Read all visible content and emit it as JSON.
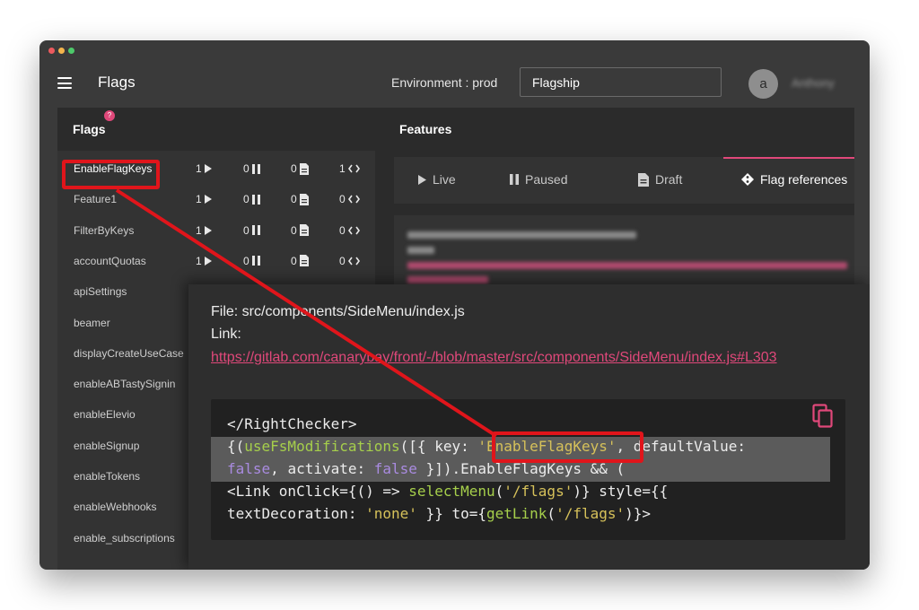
{
  "window": {
    "traffic_colors": [
      "#ec5a5e",
      "#f3b44c",
      "#4dc96a"
    ]
  },
  "header": {
    "app_title": "Flags",
    "environment_label": "Environment : prod",
    "project_value": "Flagship",
    "avatar_initial": "a",
    "user_name": "Anthony"
  },
  "flags_panel": {
    "heading": "Flags",
    "help_badge": "?",
    "flags": [
      {
        "name": "EnableFlagKeys",
        "live": "1",
        "paused": "0",
        "draft": "0",
        "refs": "1"
      },
      {
        "name": "Feature1",
        "live": "1",
        "paused": "0",
        "draft": "0",
        "refs": "0"
      },
      {
        "name": "FilterByKeys",
        "live": "1",
        "paused": "0",
        "draft": "0",
        "refs": "0"
      },
      {
        "name": "accountQuotas",
        "live": "1",
        "paused": "0",
        "draft": "0",
        "refs": "0"
      },
      {
        "name": "apiSettings"
      },
      {
        "name": "beamer"
      },
      {
        "name": "displayCreateUseCase"
      },
      {
        "name": "enableABTastySignin"
      },
      {
        "name": "enableElevio"
      },
      {
        "name": "enableSignup"
      },
      {
        "name": "enableTokens"
      },
      {
        "name": "enableWebhooks"
      },
      {
        "name": "enable_subscriptions"
      }
    ]
  },
  "features_panel": {
    "heading": "Features",
    "tabs": [
      {
        "label": "Live",
        "icon": "play-icon"
      },
      {
        "label": "Paused",
        "icon": "pause-icon"
      },
      {
        "label": "Draft",
        "icon": "document-icon"
      },
      {
        "label": "Flag references",
        "icon": "git-diamond-icon"
      }
    ],
    "active_tab": "Flag references"
  },
  "reference_popup": {
    "file_line": "File: src/components/SideMenu/index.js",
    "link_label": "Link:",
    "link_url": "https://gitlab.com/canarybay/front/-/blob/master/src/components/SideMenu/index.js#L303",
    "code": {
      "line1": "</RightChecker>",
      "line2a": "{(",
      "line2_fn": "useFsModifications",
      "line2b": "([{ key: ",
      "line2_str": "'EnableFlagKeys'",
      "line2c": ", defaultValue:",
      "line3_kw1": "false",
      "line3a": ", activate: ",
      "line3_kw2": "false",
      "line3b": " }]).EnableFlagKeys && (",
      "line4a": "<Link onClick={() => ",
      "line4_fn": "selectMenu",
      "line4b": "(",
      "line4_str": "'/flags'",
      "line4c": ")} style={{",
      "line5a": "textDecoration: ",
      "line5_str": "'none'",
      "line5b": " }} to={",
      "line5_fn": "getLink",
      "line5c": "(",
      "line5_str2": "'/flags'",
      "line5d": ")}>"
    },
    "copy_icon": "copy-icon"
  },
  "colors": {
    "accent": "#e0487a",
    "annotation_red": "#e0151b",
    "code_function": "#a6cf4b",
    "code_string": "#d6c15a",
    "code_keyword": "#a98be0"
  }
}
